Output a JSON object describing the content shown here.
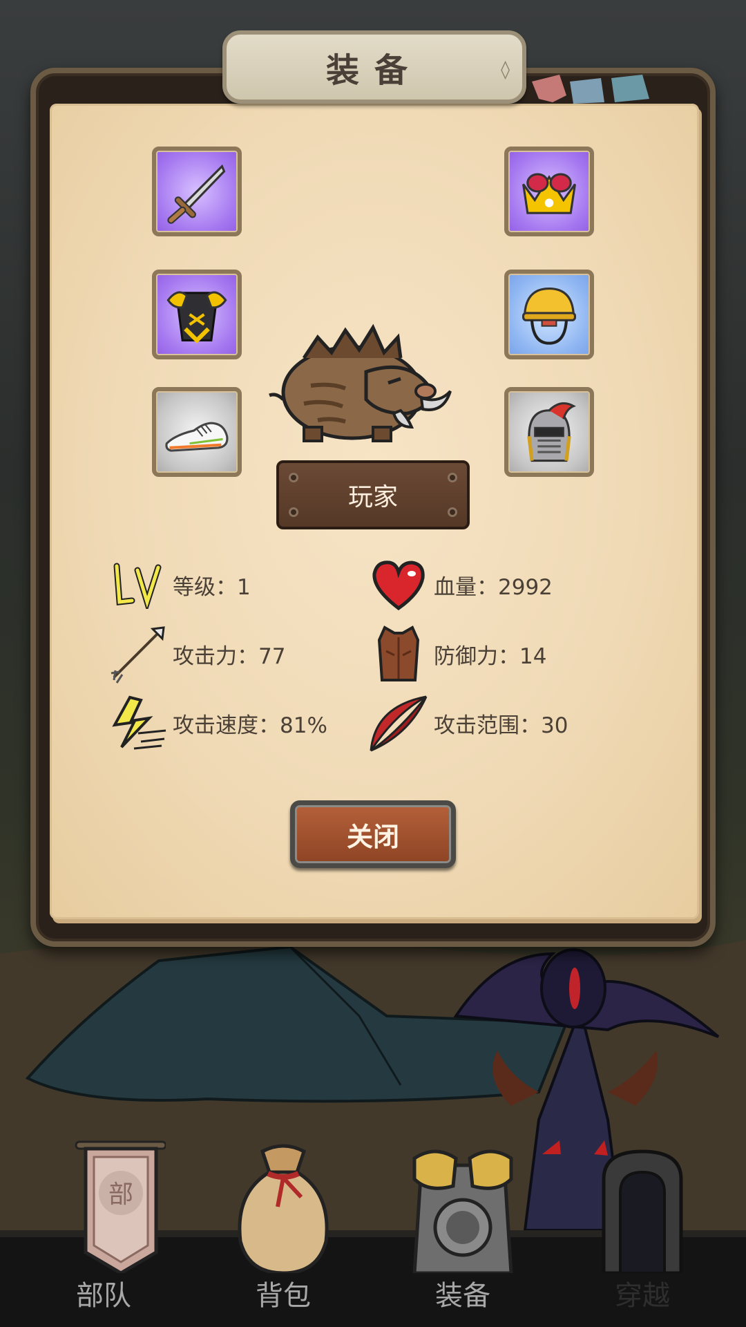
{
  "panel": {
    "title": "装备"
  },
  "equipment_slots": [
    {
      "slot": "weapon",
      "icon": "sword-icon",
      "rarity": "purple"
    },
    {
      "slot": "accessory",
      "icon": "crown-icon",
      "rarity": "purple"
    },
    {
      "slot": "armor",
      "icon": "golden-armor-icon",
      "rarity": "purple"
    },
    {
      "slot": "helmet",
      "icon": "hard-hat-icon",
      "rarity": "blue"
    },
    {
      "slot": "shoes",
      "icon": "sneaker-icon",
      "rarity": "gray"
    },
    {
      "slot": "headgear",
      "icon": "knight-helmet-icon",
      "rarity": "gray"
    }
  ],
  "character": {
    "avatar": "boar-icon",
    "name": "玩家"
  },
  "stats": [
    {
      "icon": "level-icon",
      "text": "等级：1"
    },
    {
      "icon": "heart-icon",
      "text": "血量：2992"
    },
    {
      "icon": "arrow-icon",
      "text": "攻击力：77"
    },
    {
      "icon": "leather-vest-icon",
      "text": "防御力：14"
    },
    {
      "icon": "lightning-icon",
      "text": "攻击速度：81%"
    },
    {
      "icon": "crescent-blade-icon",
      "text": "攻击范围：30"
    }
  ],
  "close_label": "关闭",
  "nav": [
    {
      "label": "部队",
      "icon": "banner-icon"
    },
    {
      "label": "背包",
      "icon": "bag-icon"
    },
    {
      "label": "装备",
      "icon": "armor-icon"
    },
    {
      "label": "穿越",
      "icon": "portal-icon"
    }
  ],
  "nav_badge": "部",
  "colors": {
    "panel_bg": "#f0dab6",
    "close_button": "#a3532f",
    "text": "#4a4036"
  }
}
